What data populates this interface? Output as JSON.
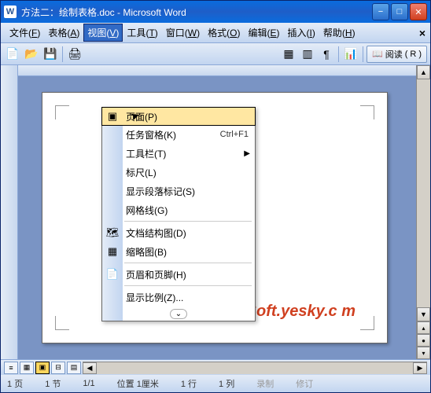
{
  "titlebar": {
    "title": "方法二：绘制表格.doc - Microsoft Word"
  },
  "menubar": {
    "items": [
      {
        "label": "文件",
        "key": "F"
      },
      {
        "label": "表格",
        "key": "A"
      },
      {
        "label": "视图",
        "key": "V"
      },
      {
        "label": "工具",
        "key": "T"
      },
      {
        "label": "窗口",
        "key": "W"
      },
      {
        "label": "格式",
        "key": "O"
      },
      {
        "label": "编辑",
        "key": "E"
      },
      {
        "label": "插入",
        "key": "I"
      },
      {
        "label": "帮助",
        "key": "H"
      }
    ]
  },
  "toolbar": {
    "read_label": "阅读",
    "read_key": "R"
  },
  "dropdown": {
    "items": [
      {
        "label": "页面",
        "key": "P",
        "icon": "page-icon",
        "highlighted": true
      },
      {
        "label": "任务窗格",
        "key": "K",
        "shortcut": "Ctrl+F1"
      },
      {
        "label": "工具栏",
        "key": "T",
        "submenu": true
      },
      {
        "label": "标尺",
        "key": "L"
      },
      {
        "label": "显示段落标记",
        "key": "S"
      },
      {
        "label": "网格线",
        "key": "G"
      },
      {
        "sep": true
      },
      {
        "label": "文档结构图",
        "key": "D",
        "icon": "docmap-icon"
      },
      {
        "label": "缩略图",
        "key": "B",
        "icon": "thumbnail-icon"
      },
      {
        "sep": true
      },
      {
        "label": "页眉和页脚",
        "key": "H",
        "icon": "header-footer-icon"
      },
      {
        "sep": true
      },
      {
        "label": "显示比例",
        "key": "Z",
        "ellipsis": true
      }
    ]
  },
  "watermark": "Soft.yesky.c   m",
  "statusbar": {
    "page": "1 页",
    "section": "1 节",
    "pages": "1/1",
    "position": "位置 1厘米",
    "line": "1 行",
    "column": "1 列",
    "rec": "录制",
    "rev": "修订"
  }
}
